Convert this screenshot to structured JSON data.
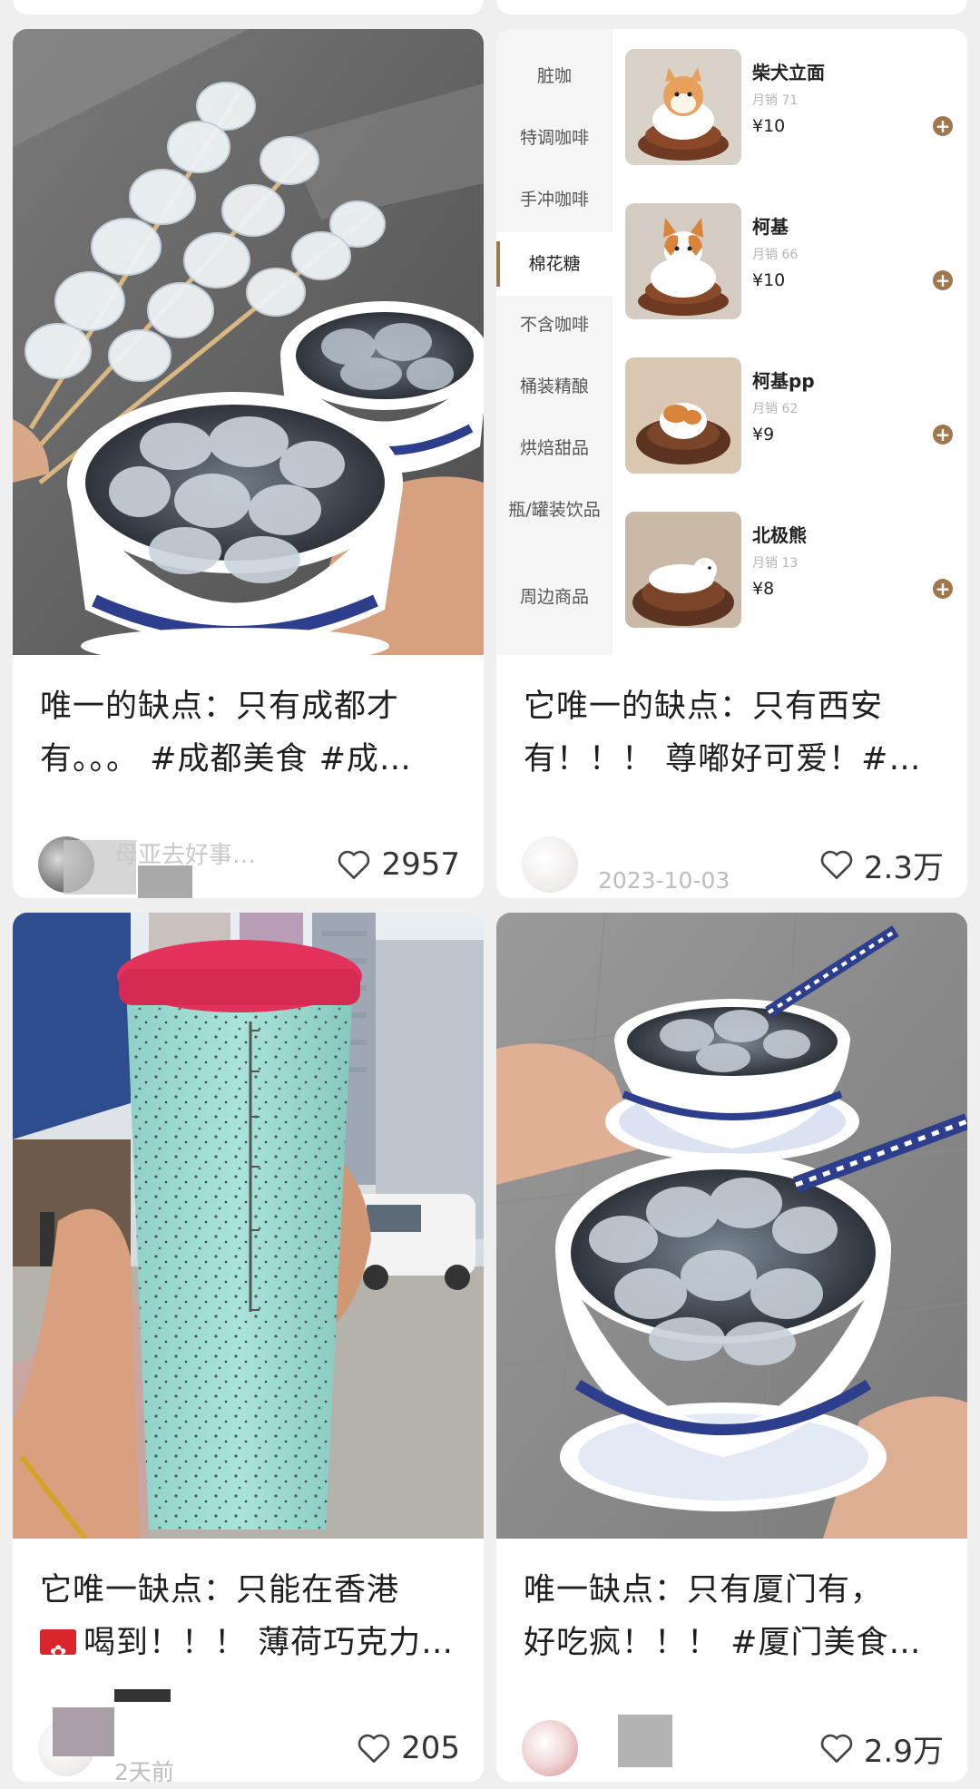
{
  "colors": {
    "background": "#efefef",
    "card": "#ffffff",
    "menu_accent": "#a0764d",
    "title_text": "#1f1f1f"
  },
  "cards": [
    {
      "image_subject": "grass jelly dessert in blue-and-white bowls with skewers",
      "title_line1": "唯一的缺点：只有成都才",
      "title_line2": "有。。。 #成都美食 #成…",
      "author": "母亚去好事…",
      "date": "",
      "like_icon": "heart-outline-icon",
      "likes": "2957"
    },
    {
      "image_subject": "coffee shop ordering menu screenshot",
      "menu": {
        "categories": [
          "脏咖",
          "特调咖啡",
          "手冲咖啡",
          "棉花糖",
          "不含咖啡",
          "桶装精酿",
          "烘焙甜品",
          "瓶/罐装饮品",
          "周边商品"
        ],
        "active_category": "棉花糖",
        "products": [
          {
            "name": "柴犬立面",
            "sales": "月销 71",
            "price": "¥10"
          },
          {
            "name": "柯基",
            "sales": "月销 66",
            "price": "¥10"
          },
          {
            "name": "柯基pp",
            "sales": "月销 62",
            "price": "¥9"
          },
          {
            "name": "北极熊",
            "sales": "月销 13",
            "price": "¥8"
          }
        ],
        "add_icon": "plus-circle-icon"
      },
      "title_line1": "它唯一的缺点：只有西安",
      "title_line2": "有！！！ 尊嘟好可爱！#…",
      "author": "",
      "date": "2023-10-03",
      "like_icon": "heart-outline-icon",
      "likes": "2.3万"
    },
    {
      "image_subject": "mint chocolate chip drink cup on a Hong Kong street",
      "title_line1": "它唯一缺点：只能在香港",
      "flag_icon": "hong-kong-flag-icon",
      "title_line2": "喝到！！！ 薄荷巧克力…",
      "author": "",
      "date": "2天前",
      "like_icon": "heart-outline-icon",
      "likes": "205"
    },
    {
      "image_subject": "two bowls of grass jelly with porcelain spoons",
      "title_line1": "唯一缺点：只有厦门有，",
      "title_line2": "好吃疯！！！ #厦门美食…",
      "author": "",
      "date": "",
      "like_icon": "heart-outline-icon",
      "likes": "2.9万"
    }
  ]
}
